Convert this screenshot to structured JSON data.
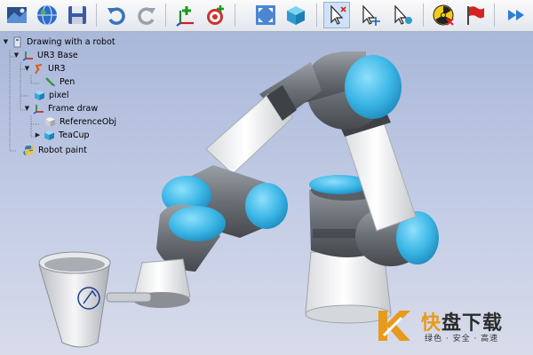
{
  "toolbar": {
    "buttons": [
      {
        "name": "new-scene-icon"
      },
      {
        "name": "globe-icon"
      },
      {
        "name": "save-icon"
      },
      {
        "name": "undo-icon"
      },
      {
        "name": "redo-icon"
      },
      {
        "name": "add-frame-icon"
      },
      {
        "name": "add-target-icon"
      },
      {
        "name": "fit-all-icon"
      },
      {
        "name": "cube-view-icon"
      },
      {
        "name": "select-pointer-icon"
      },
      {
        "name": "select-move-icon"
      },
      {
        "name": "select-frame-icon"
      },
      {
        "name": "radiation-stop-icon"
      },
      {
        "name": "flag-icon"
      },
      {
        "name": "fast-forward-icon"
      }
    ]
  },
  "tree": {
    "root": "Drawing with a robot",
    "items": [
      {
        "label": "UR3 Base"
      },
      {
        "label": "UR3"
      },
      {
        "label": "Pen"
      },
      {
        "label": "pixel"
      },
      {
        "label": "Frame draw"
      },
      {
        "label": "ReferenceObj"
      },
      {
        "label": "TeaCup"
      },
      {
        "label": "Robot paint"
      }
    ]
  },
  "watermark": {
    "title_orange": "快",
    "title_rest": "盘下载",
    "subtitle": "绿色 · 安全 · 高速"
  },
  "colors": {
    "accent_cyan": "#3fb8e8",
    "robot_gray": "#6f7378",
    "robot_white": "#f0f1f3",
    "brand_orange": "#e89a1c"
  }
}
